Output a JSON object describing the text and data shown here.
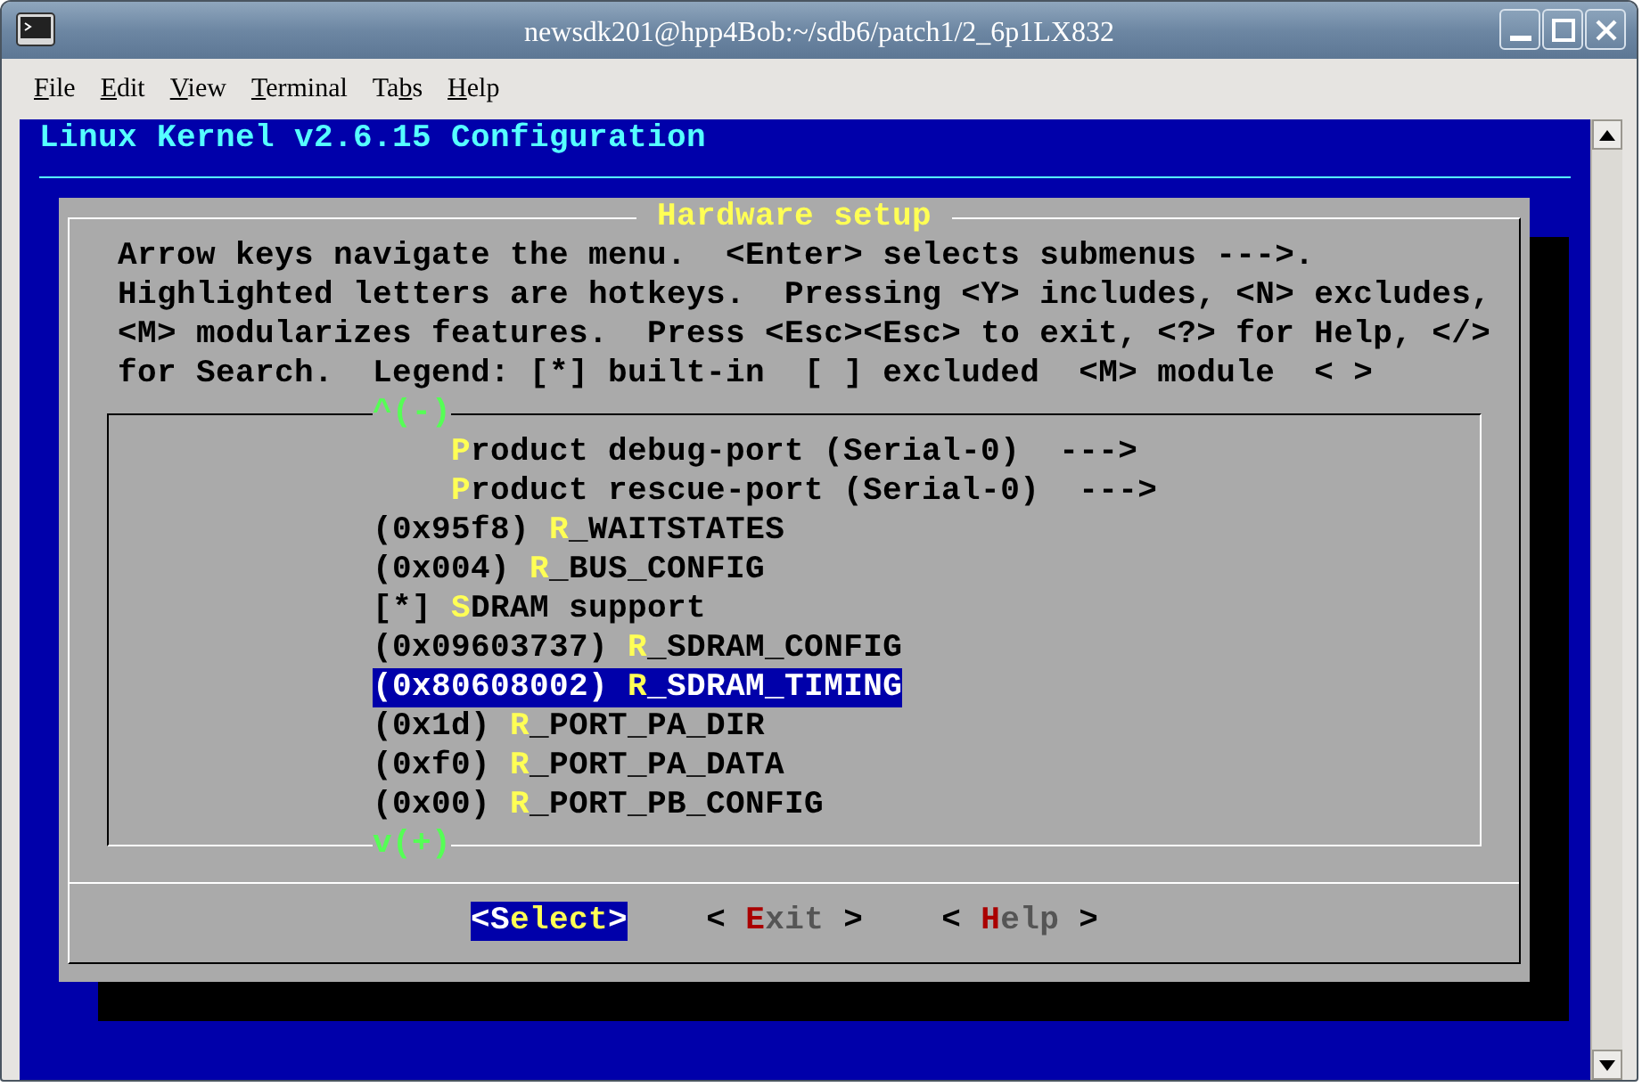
{
  "window": {
    "title": "newsdk201@hpp4Bob:~/sdb6/patch1/2_6p1LX832"
  },
  "menu": [
    {
      "key": "F",
      "after": "ile"
    },
    {
      "key": "E",
      "after": "dit"
    },
    {
      "key": "V",
      "after": "iew"
    },
    {
      "key": "T",
      "after": "erminal"
    },
    {
      "before": "Ta",
      "key": "b",
      "after": "s"
    },
    {
      "key": "H",
      "after": "elp"
    }
  ],
  "terminal": {
    "title": "Linux Kernel v2.6.15 Configuration",
    "dialog": {
      "title": "Hardware setup",
      "help": [
        "Arrow keys navigate the menu.  <Enter> selects submenus --->.",
        "Highlighted letters are hotkeys.  Pressing <Y> includes, <N> excludes,",
        "<M> modularizes features.  Press <Esc><Esc> to exit, <?> for Help, </>",
        "for Search.  Legend: [*] built-in  [ ] excluded  <M> module  < >"
      ],
      "list": {
        "top_marker": "^(-)",
        "bottom_marker": "v(+)",
        "items": [
          {
            "kind": "choice",
            "hotkey": "P",
            "rest": "roduct debug-port (Serial-0)  --->",
            "selected": false
          },
          {
            "kind": "choice",
            "hotkey": "P",
            "rest": "roduct rescue-port (Serial-0)  --->",
            "selected": false
          },
          {
            "kind": "option",
            "value": "(0x95f8)",
            "hotkey": "R",
            "rest": "_WAITSTATES",
            "selected": false
          },
          {
            "kind": "option",
            "value": "(0x004)",
            "hotkey": "R",
            "rest": "_BUS_CONFIG",
            "selected": false
          },
          {
            "kind": "option",
            "value": "[*]",
            "hotkey": "S",
            "rest": "DRAM support",
            "selected": false
          },
          {
            "kind": "option",
            "value": "(0x09603737)",
            "hotkey": "R",
            "rest": "_SDRAM_CONFIG",
            "selected": false
          },
          {
            "kind": "option",
            "value": "(0x80608002)",
            "hotkey": "R",
            "rest": "_SDRAM_TIMING",
            "selected": true
          },
          {
            "kind": "option",
            "value": "(0x1d)",
            "hotkey": "R",
            "rest": "_PORT_PA_DIR",
            "selected": false
          },
          {
            "kind": "option",
            "value": "(0xf0)",
            "hotkey": "R",
            "rest": "_PORT_PA_DATA",
            "selected": false
          },
          {
            "kind": "option",
            "value": "(0x00)",
            "hotkey": "R",
            "rest": "_PORT_PB_CONFIG",
            "selected": false
          }
        ]
      },
      "buttons": [
        {
          "left": "<",
          "hotkey": "S",
          "rest": "elect",
          "right": ">",
          "selected": true
        },
        {
          "left": "< ",
          "hotkey": "E",
          "rest": "xit",
          "right": " >",
          "selected": false
        },
        {
          "left": "< ",
          "hotkey": "H",
          "rest": "elp",
          "right": " >",
          "selected": false
        }
      ]
    }
  }
}
